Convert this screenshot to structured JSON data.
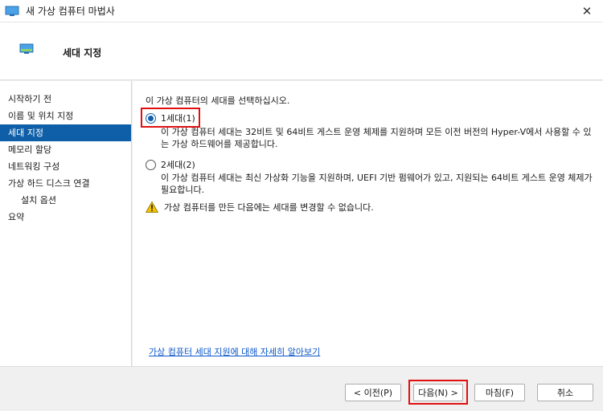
{
  "window": {
    "title": "새 가상 컴퓨터 마법사",
    "close_glyph": "✕"
  },
  "header": {
    "title": "세대 지정",
    "icon": "monitor-icon"
  },
  "sidebar": {
    "items": [
      {
        "label": "시작하기 전"
      },
      {
        "label": "이름 및 위치 지정"
      },
      {
        "label": "세대 지정"
      },
      {
        "label": "메모리 할당"
      },
      {
        "label": "네트워킹 구성"
      },
      {
        "label": "가상 하드 디스크 연결"
      },
      {
        "label": "설치 옵션"
      },
      {
        "label": "요약"
      }
    ],
    "active_index": 2
  },
  "content": {
    "prompt": "이 가상 컴퓨터의 세대를 선택하십시오.",
    "options": [
      {
        "label": "1세대(1)",
        "checked": true,
        "description": "이 가상 컴퓨터 세대는 32비트 및 64비트 게스트 운영 체제를 지원하며 모든 이전 버전의 Hyper-V에서 사용할 수 있는 가상 하드웨어를 제공합니다."
      },
      {
        "label": "2세대(2)",
        "checked": false,
        "description": "이 가상 컴퓨터 세대는 최신 가상화 기능을 지원하며, UEFI 기반 펌웨어가 있고, 지원되는 64비트 게스트 운영 체제가 필요합니다."
      }
    ],
    "warning": "가상 컴퓨터를 만든 다음에는 세대를 변경할 수 없습니다.",
    "learn_more_link": "가상 컴퓨터 세대 지원에 대해 자세히 알아보기"
  },
  "footer": {
    "prev_label": "< 이전(P)",
    "next_label": "다음(N) >",
    "finish_label": "마침(F)",
    "cancel_label": "취소"
  },
  "colors": {
    "accent": "#0f5fa8",
    "highlight_box": "#e01010",
    "link": "#0b57c9",
    "warning": "#f2c200"
  }
}
